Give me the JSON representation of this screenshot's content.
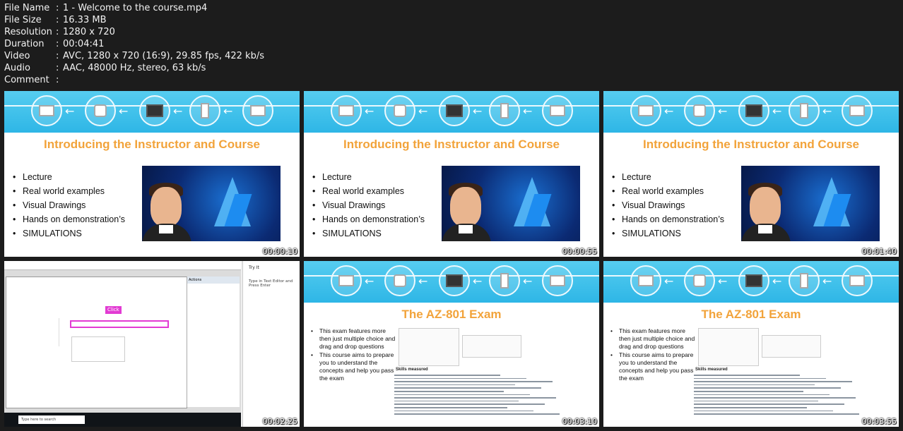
{
  "meta": [
    {
      "key": "File Name",
      "value": "1 - Welcome to the course.mp4"
    },
    {
      "key": "File Size",
      "value": "16.33 MB"
    },
    {
      "key": "Resolution",
      "value": "1280 x 720"
    },
    {
      "key": "Duration",
      "value": "00:04:41"
    },
    {
      "key": "Video",
      "value": "AVC, 1280 x 720 (16:9), 29.85 fps, 422 kb/s"
    },
    {
      "key": "Audio",
      "value": "AAC, 48000 Hz, stereo, 63 kb/s"
    },
    {
      "key": "Comment",
      "value": ""
    }
  ],
  "separator": ":",
  "slides": {
    "intro_title": "Introducing the Instructor and Course",
    "intro_bullets": [
      "Lecture",
      "Real world examples",
      "Visual Drawings",
      "Hands on demonstration’s",
      "SIMULATIONS"
    ],
    "exam_title": "The AZ-801 Exam",
    "exam_bullets": [
      "This exam features more then just multiple choice and drag and drop questions",
      "This course aims to prepare you to understand the concepts and help you pass the exam"
    ],
    "exam_skills_heading": "Skills measured"
  },
  "screen": {
    "tryit_label": "Try It",
    "tryit_text": "Type in Text Editor and Press Enter",
    "click_badge": "Click",
    "actions_label": "Actions",
    "search_placeholder": "Type here to search"
  },
  "thumbnails": [
    {
      "type": "intro",
      "timestamp": "00:00:10"
    },
    {
      "type": "intro",
      "timestamp": "00:00:55"
    },
    {
      "type": "intro",
      "timestamp": "00:01:40"
    },
    {
      "type": "screen",
      "timestamp": "00:02:25"
    },
    {
      "type": "exam",
      "timestamp": "00:03:10"
    },
    {
      "type": "exam",
      "timestamp": "00:03:55"
    }
  ],
  "colors": {
    "banner": "#2eb6e6",
    "title": "#f2a33a",
    "background": "#1c1c1c"
  }
}
